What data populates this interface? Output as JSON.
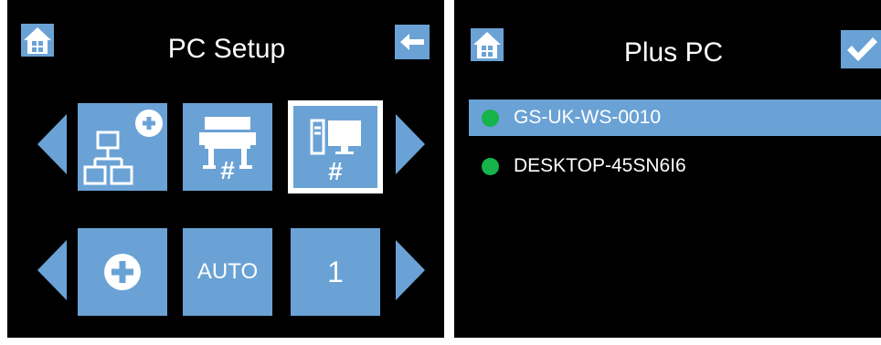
{
  "pc_setup": {
    "title": "PC Setup",
    "icons": {
      "home": "home-icon",
      "back": "back-arrow-icon",
      "prev": "triangle-left-icon",
      "next": "triangle-right-icon"
    },
    "row1": [
      {
        "name": "add-network-pc",
        "icon": "network-add-icon"
      },
      {
        "name": "printer-number",
        "icon": "printer-icon",
        "label": "#"
      },
      {
        "name": "pc-number",
        "icon": "computer-icon",
        "label": "#",
        "selected": true
      }
    ],
    "row2": [
      {
        "name": "add",
        "icon": "plus-circle-icon"
      },
      {
        "name": "auto",
        "label": "AUTO"
      },
      {
        "name": "number",
        "label": "1"
      }
    ]
  },
  "plus_pc": {
    "title": "Plus PC",
    "icons": {
      "home": "home-icon",
      "confirm": "checkmark-icon"
    },
    "items": [
      {
        "label": "GS-UK-WS-0010",
        "status": "online",
        "selected": true
      },
      {
        "label": "DESKTOP-45SN6I6",
        "status": "online",
        "selected": false
      }
    ]
  },
  "colors": {
    "accent": "#6aa2d5",
    "background": "#000000",
    "status_online": "#16b34a"
  }
}
